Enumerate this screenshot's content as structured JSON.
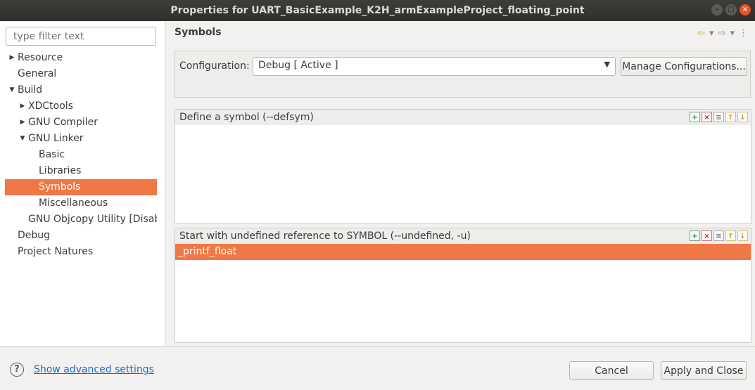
{
  "window": {
    "title": "Properties for UART_BasicExample_K2H_armExampleProject_floating_point"
  },
  "filter": {
    "placeholder": "type filter text"
  },
  "tree": [
    {
      "label": "Resource",
      "level": 0,
      "arrow": "right"
    },
    {
      "label": "General",
      "level": 0,
      "arrow": "none"
    },
    {
      "label": "Build",
      "level": 0,
      "arrow": "down"
    },
    {
      "label": "XDCtools",
      "level": 1,
      "arrow": "right"
    },
    {
      "label": "GNU Compiler",
      "level": 1,
      "arrow": "right"
    },
    {
      "label": "GNU Linker",
      "level": 1,
      "arrow": "down"
    },
    {
      "label": "Basic",
      "level": 2,
      "arrow": "none"
    },
    {
      "label": "Libraries",
      "level": 2,
      "arrow": "none"
    },
    {
      "label": "Symbols",
      "level": 2,
      "arrow": "none",
      "selected": true
    },
    {
      "label": "Miscellaneous",
      "level": 2,
      "arrow": "none"
    },
    {
      "label": "GNU Objcopy Utility  [Disab",
      "level": 1,
      "arrow": "none"
    },
    {
      "label": "Debug",
      "level": 0,
      "arrow": "none"
    },
    {
      "label": "Project Natures",
      "level": 0,
      "arrow": "none"
    }
  ],
  "page": {
    "title": "Symbols"
  },
  "config": {
    "label": "Configuration:",
    "value": "Debug  [ Active ]",
    "manage_label": "Manage Configurations..."
  },
  "defsym": {
    "header": "Define a symbol (--defsym)",
    "items": []
  },
  "undefined": {
    "header": "Start with undefined reference to SYMBOL (--undefined, -u)",
    "items": [
      "_printf_float"
    ]
  },
  "bottom": {
    "advanced_link": "Show advanced settings",
    "cancel_label": "Cancel",
    "apply_label": "Apply and Close"
  },
  "colors": {
    "selection": "#f07746",
    "titlebar": "#3d3d3a"
  }
}
